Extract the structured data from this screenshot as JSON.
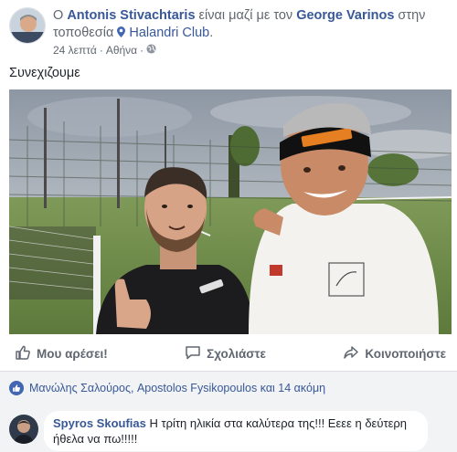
{
  "post": {
    "prefix": "Ο ",
    "author": "Antonis Stivachtaris",
    "with_text": " είναι μαζί με τον ",
    "tagged": "George Varinos",
    "place_text": " στην τοποθεσία ",
    "place": "Halandri Club",
    "place_suffix": ".",
    "time": "24 λεπτά",
    "separator": "·",
    "city": "Αθήνα",
    "separator2": "·",
    "text": "Συνεχιζουμε"
  },
  "actions": {
    "like": "Μου αρέσει!",
    "comment": "Σχολιάστε",
    "share": "Κοινοποιήστε"
  },
  "reactions": {
    "text": "Μανώλης Σαλούρος, Apostolos Fysikopoulos και 14 ακόμη"
  },
  "comment": {
    "author": "Spyros Skoufias",
    "text": " Η τρίτη ηλικία στα καλύτερα της!!! Εεεε η δεύτερη ήθελα να πω!!!!!"
  },
  "colors": {
    "link": "#385898",
    "meta": "#606770",
    "like_badge": "#4267b2",
    "comment_bg": "#f2f3f5"
  },
  "icons": {
    "location": "location-pin-icon",
    "privacy": "globe-icon",
    "like": "thumbs-up-icon",
    "comment": "speech-bubble-icon",
    "share": "share-arrow-icon",
    "reaction": "like-reaction-icon"
  }
}
